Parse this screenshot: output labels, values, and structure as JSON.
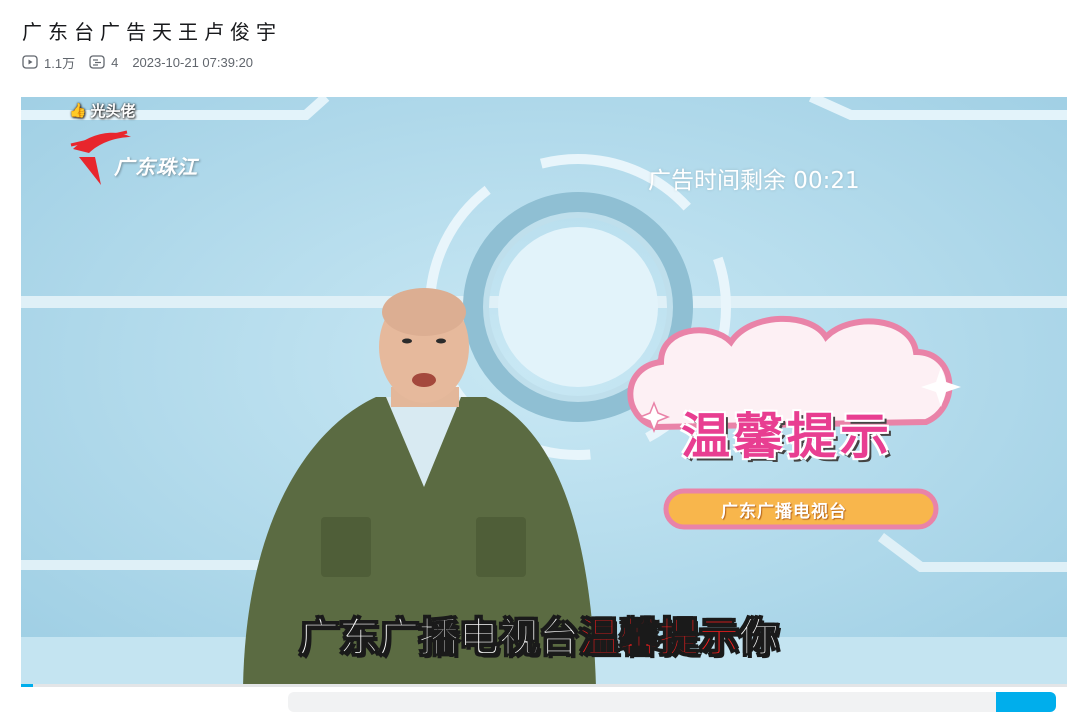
{
  "video": {
    "title": "广东台广告天王卢俊宇",
    "views": "1.1万",
    "danmaku_count": "4",
    "publish_time": "2023-10-21 07:39:20"
  },
  "player": {
    "uploader_tag": "光头佬",
    "channel_logo_text": "广东珠江",
    "countdown_text": "广告时间剩余 00:21",
    "cloud_title": "温馨提示",
    "cloud_sub": "广东广播电视台",
    "subtitle_a": "广东广播电视台",
    "subtitle_b": "温馨提示",
    "subtitle_c": "你",
    "progress": 0.011
  },
  "icons": {
    "views": "play-count-icon",
    "danmaku": "danmaku-count-icon",
    "uploader": "thumbs-up-icon"
  },
  "colors": {
    "accent": "#00aeec",
    "logo_red": "#e8262d",
    "cloud_pink": "#e83e91",
    "subtitle_red": "#ff1e1e"
  }
}
